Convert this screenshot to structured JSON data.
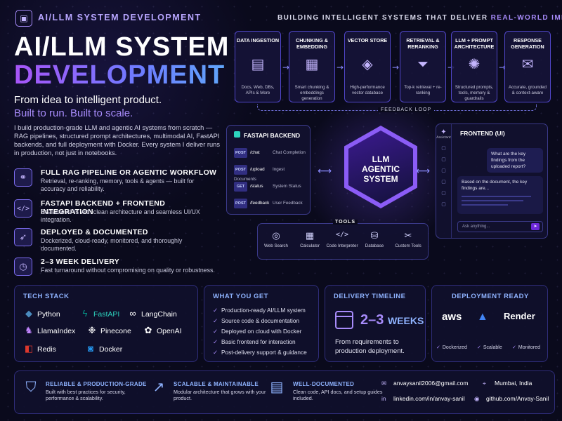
{
  "header": {
    "top_label": "AI/LLM SYSTEM DEVELOPMENT",
    "title_line1": "AI/LLM SYSTEM",
    "title_line2": "DEVELOPMENT",
    "tagline1": "From idea to intelligent product.",
    "tagline2": "Built to run. Built to scale.",
    "intro": "I build production-grade LLM and agentic AI systems from scratch — RAG pipelines, structured prompt architectures, multimodal AI, FastAPI backends, and full deployment with Docker. Every system I deliver runs in production, not just in notebooks."
  },
  "features": [
    {
      "icon": "workflow-icon",
      "title": "FULL RAG PIPELINE OR AGENTIC WORKFLOW",
      "desc": "Retrieval, re-ranking, memory, tools & agents — built for accuracy and reliability."
    },
    {
      "icon": "code-icon",
      "title": "FASTAPI BACKEND + FRONTEND INTEGRATION",
      "desc": "Scalable APIs with clean architecture and seamless UI/UX integration."
    },
    {
      "icon": "rocket-icon",
      "title": "DEPLOYED & DOCUMENTED",
      "desc": "Dockerized, cloud-ready, monitored, and thoroughly documented."
    },
    {
      "icon": "clock-icon",
      "title": "2–3 WEEK DELIVERY",
      "desc": "Fast turnaround without compromising on quality or robustness."
    }
  ],
  "pipeline": {
    "heading": "BUILDING INTELLIGENT SYSTEMS THAT DELIVER",
    "heading_highlight": "REAL-WORLD IMPACT",
    "stages": [
      {
        "name": "DATA INGESTION",
        "glyph": "▤",
        "desc": "Docs, Web, DBs, APIs & More"
      },
      {
        "name": "CHUNKING & EMBEDDING",
        "glyph": "▦",
        "desc": "Smart chunking & embeddings generation"
      },
      {
        "name": "VECTOR STORE",
        "glyph": "◈",
        "desc": "High-performance vector database"
      },
      {
        "name": "RETRIEVAL & RERANKING",
        "glyph": "⏷",
        "desc": "Top-k retrieval + re-ranking"
      },
      {
        "name": "LLM + PROMPT ARCHITECTURE",
        "glyph": "✺",
        "desc": "Structured prompts, tools, memory & guardrails"
      },
      {
        "name": "RESPONSE GENERATION",
        "glyph": "✉",
        "desc": "Accurate, grounded & context-aware"
      }
    ],
    "feedback_label": "FEEDBACK LOOP"
  },
  "backend": {
    "title": "FASTAPI BACKEND",
    "endpoints": [
      {
        "method": "POST",
        "path": "/chat",
        "desc": "Chat Completion"
      },
      {
        "method": "POST",
        "path": "/upload",
        "desc": "Ingest Documents"
      },
      {
        "method": "GET",
        "path": "/status",
        "desc": "System Status"
      },
      {
        "method": "POST",
        "path": "/feedback",
        "desc": "User Feedback"
      }
    ]
  },
  "core": {
    "line1": "LLM",
    "line2": "AGENTIC",
    "line3": "SYSTEM"
  },
  "frontend": {
    "title": "FRONTEND (UI)",
    "side_label": "Assistant",
    "user_msg": "What are the key findings from the uploaded report?",
    "bot_msg": "Based on the document, the key findings are...",
    "input_placeholder": "Ask anything..."
  },
  "tools": {
    "label": "TOOLS",
    "items": [
      {
        "icon": "globe-icon",
        "glyph": "🌐︎",
        "label": "Web Search"
      },
      {
        "icon": "calculator-icon",
        "glyph": "▦",
        "label": "Calculator"
      },
      {
        "icon": "code-icon",
        "glyph": "</>",
        "label": "Code Interpreter"
      },
      {
        "icon": "database-icon",
        "glyph": "⛁",
        "label": "Database"
      },
      {
        "icon": "wrench-icon",
        "glyph": "✂",
        "label": "Custom Tools"
      }
    ]
  },
  "tech_stack": {
    "heading": "TECH STACK",
    "items": [
      {
        "name": "Python",
        "glyph": "◆",
        "color": "#4b8bbe"
      },
      {
        "name": "FastAPI",
        "glyph": "ϟ",
        "color": "#05998b"
      },
      {
        "name": "LangChain",
        "glyph": "∞",
        "color": "#ffffff"
      },
      {
        "name": "LlamaIndex",
        "glyph": "♞",
        "color": "#c084fc"
      },
      {
        "name": "Pinecone",
        "glyph": "❉",
        "color": "#ffffff"
      },
      {
        "name": "OpenAI",
        "glyph": "✿",
        "color": "#ffffff"
      },
      {
        "name": "Redis",
        "glyph": "◧",
        "color": "#dc382d"
      },
      {
        "name": "Docker",
        "glyph": "◙",
        "color": "#2496ed"
      }
    ]
  },
  "what_you_get": {
    "heading": "WHAT YOU GET",
    "items": [
      "Production-ready AI/LLM system",
      "Source code & documentation",
      "Deployed on cloud with Docker",
      "Basic frontend for interaction",
      "Post-delivery support & guidance"
    ]
  },
  "timeline": {
    "heading": "DELIVERY TIMELINE",
    "value": "2–3",
    "unit": "WEEKS",
    "desc": "From requirements to production deployment."
  },
  "deployment": {
    "heading": "DEPLOYMENT READY",
    "providers": [
      "aws",
      "▲",
      "Render"
    ],
    "badges": [
      "Dockerized",
      "Scalable",
      "Monitored"
    ]
  },
  "footer": {
    "items": [
      {
        "icon": "shield-icon",
        "glyph": "⛉",
        "title": "RELIABLE & PRODUCTION-GRADE",
        "desc": "Built with best practices for security, performance & scalability."
      },
      {
        "icon": "growth-chart-icon",
        "glyph": "↗",
        "title": "SCALABLE & MAINTAINABLE",
        "desc": "Modular architecture that grows with your product."
      },
      {
        "icon": "document-icon",
        "glyph": "▤",
        "title": "WELL-DOCUMENTED",
        "desc": "Clean code, API docs, and setup guides included."
      }
    ],
    "contact": {
      "email": "anvaysanil2006@gmail.com",
      "location": "Mumbai, India",
      "linkedin": "linkedin.com/in/anvay-sanil",
      "github": "github.com/Anvay-Sanil"
    }
  }
}
